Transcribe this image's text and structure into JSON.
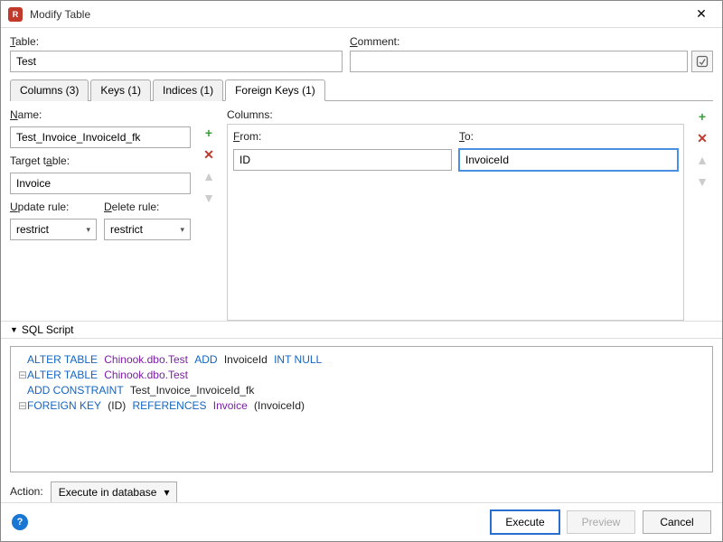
{
  "window": {
    "title": "Modify Table",
    "close_glyph": "✕"
  },
  "labels": {
    "table": "able:",
    "table_u": "T",
    "comment": "omment:",
    "comment_u": "C",
    "name": "ame:",
    "name_u": "N",
    "target": "Target t",
    "target_rest": "ble:",
    "target_u": "a",
    "update": "pdate rule:",
    "update_u": "U",
    "delete": "elete rule:",
    "delete_u": "D",
    "columns": "Columns:",
    "from": "rom:",
    "from_u": "F",
    "to": "o:",
    "to_u": "T",
    "sql_script": "SQL Script",
    "action": "Action:"
  },
  "values": {
    "table": "Test",
    "comment": "",
    "fk_name": "Test_Invoice_InvoiceId_fk",
    "target_table": "Invoice",
    "update_rule": "restrict",
    "delete_rule": "restrict",
    "from_col": "ID",
    "to_col": "InvoiceId",
    "action_sel": "Execute in database"
  },
  "tabs": [
    {
      "label": "Columns (3)",
      "active": false
    },
    {
      "label": "Keys (1)",
      "active": false
    },
    {
      "label": "Indices (1)",
      "active": false
    },
    {
      "label": "Foreign Keys (1)",
      "active": true
    }
  ],
  "buttons": {
    "execute": "Execute",
    "preview": "Preview",
    "cancel": "Cancel",
    "help": "?",
    "expand": "⮐"
  },
  "sql": {
    "l1a": "ALTER TABLE",
    "l1b": "Chinook.dbo.Test",
    "l1c": "ADD",
    "l1d": "InvoiceId",
    "l1e": "INT NULL",
    "l2a": "ALTER TABLE",
    "l2b": "Chinook.dbo.Test",
    "l3a": "ADD CONSTRAINT",
    "l3b": "Test_Invoice_InvoiceId_fk",
    "l4a": "FOREIGN KEY",
    "l4b": "(ID)",
    "l4c": "REFERENCES",
    "l4d": "Invoice",
    "l4e": "(InvoiceId)"
  }
}
